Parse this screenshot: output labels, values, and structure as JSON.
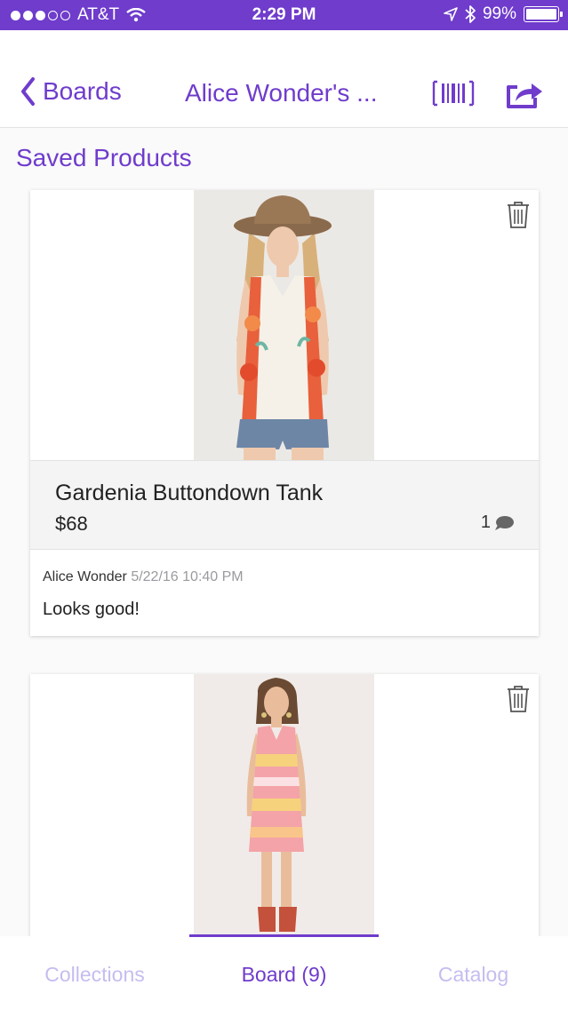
{
  "status_bar": {
    "carrier": "AT&T",
    "time": "2:29 PM",
    "battery": "99%",
    "signal_bars_filled": 3,
    "signal_bars_total": 5,
    "battery_level": 0.99
  },
  "nav": {
    "back_label": "Boards",
    "title": "Alice Wonder's ...",
    "icons": [
      "chevron-left-icon",
      "barcode-icon",
      "share-icon"
    ]
  },
  "main": {
    "section_title": "Saved Products",
    "products": [
      {
        "name": "Gardenia Buttondown Tank",
        "price": "$68",
        "comment_count": "1",
        "comment": {
          "author": "Alice Wonder",
          "date": "5/22/16 10:40 PM",
          "text": "Looks good!"
        }
      }
    ]
  },
  "tabs": [
    {
      "label": "Collections",
      "active": false
    },
    {
      "label": "Board (9)",
      "active": true
    },
    {
      "label": "Catalog",
      "active": false
    }
  ],
  "colors": {
    "accent": "#6f3ccc",
    "inactive_tab": "#c7bcf0",
    "panel_bg": "#f4f4f5"
  }
}
